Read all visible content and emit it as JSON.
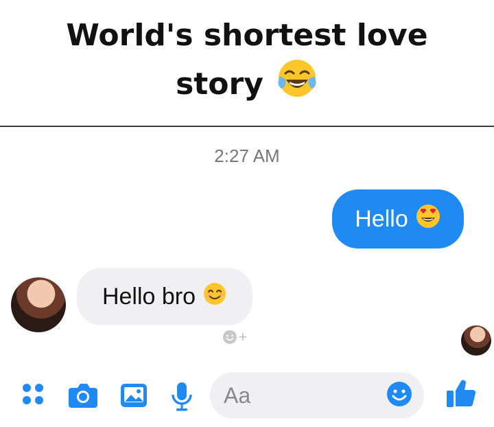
{
  "caption": {
    "line1": "World's shortest love",
    "line2": "story",
    "emoji": "tears-of-joy-emoji"
  },
  "chat": {
    "timestamp": "2:27 AM",
    "messages": [
      {
        "direction": "outgoing",
        "text": "Hello",
        "emoji": "heart-eyes-emoji"
      },
      {
        "direction": "incoming",
        "text": "Hello bro",
        "emoji": "smiling-emoji"
      }
    ],
    "react_label": "+"
  },
  "composer": {
    "placeholder": "Aa",
    "icons": [
      "apps-icon",
      "camera-icon",
      "gallery-icon",
      "microphone-icon",
      "emoji-icon",
      "like-icon"
    ]
  },
  "colors": {
    "messenger_blue": "#1f8bf2",
    "incoming_bubble": "#f0f0f2",
    "emoji_yellow": "#fcc62d"
  }
}
